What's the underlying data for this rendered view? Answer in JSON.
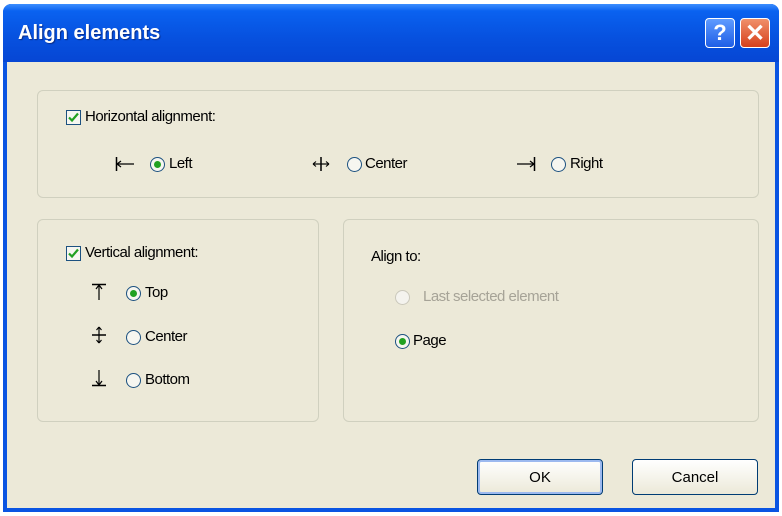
{
  "dialog": {
    "title": "Align elements",
    "help_symbol": "?",
    "close_symbol": "✕"
  },
  "horizontal": {
    "label": "Horizontal alignment:",
    "checked": true,
    "options": [
      {
        "label": "Left",
        "icon": "align-left-icon",
        "selected": true
      },
      {
        "label": "Center",
        "icon": "align-center-horizontal-icon",
        "selected": false
      },
      {
        "label": "Right",
        "icon": "align-right-icon",
        "selected": false
      }
    ]
  },
  "vertical": {
    "label": "Vertical alignment:",
    "checked": true,
    "options": [
      {
        "label": "Top",
        "icon": "align-top-icon",
        "selected": true
      },
      {
        "label": "Center",
        "icon": "align-center-vertical-icon",
        "selected": false
      },
      {
        "label": "Bottom",
        "icon": "align-bottom-icon",
        "selected": false
      }
    ]
  },
  "align_to": {
    "label": "Align to:",
    "options": [
      {
        "label": "Last selected element",
        "selected": false,
        "disabled": true
      },
      {
        "label": "Page",
        "selected": true,
        "disabled": false
      }
    ]
  },
  "buttons": {
    "ok": "OK",
    "cancel": "Cancel"
  },
  "colors": {
    "titlebar": "#0752e0",
    "dialog_bg": "#ece9d8",
    "radio_dot": "#21a121",
    "disabled_text": "#a6a397"
  }
}
